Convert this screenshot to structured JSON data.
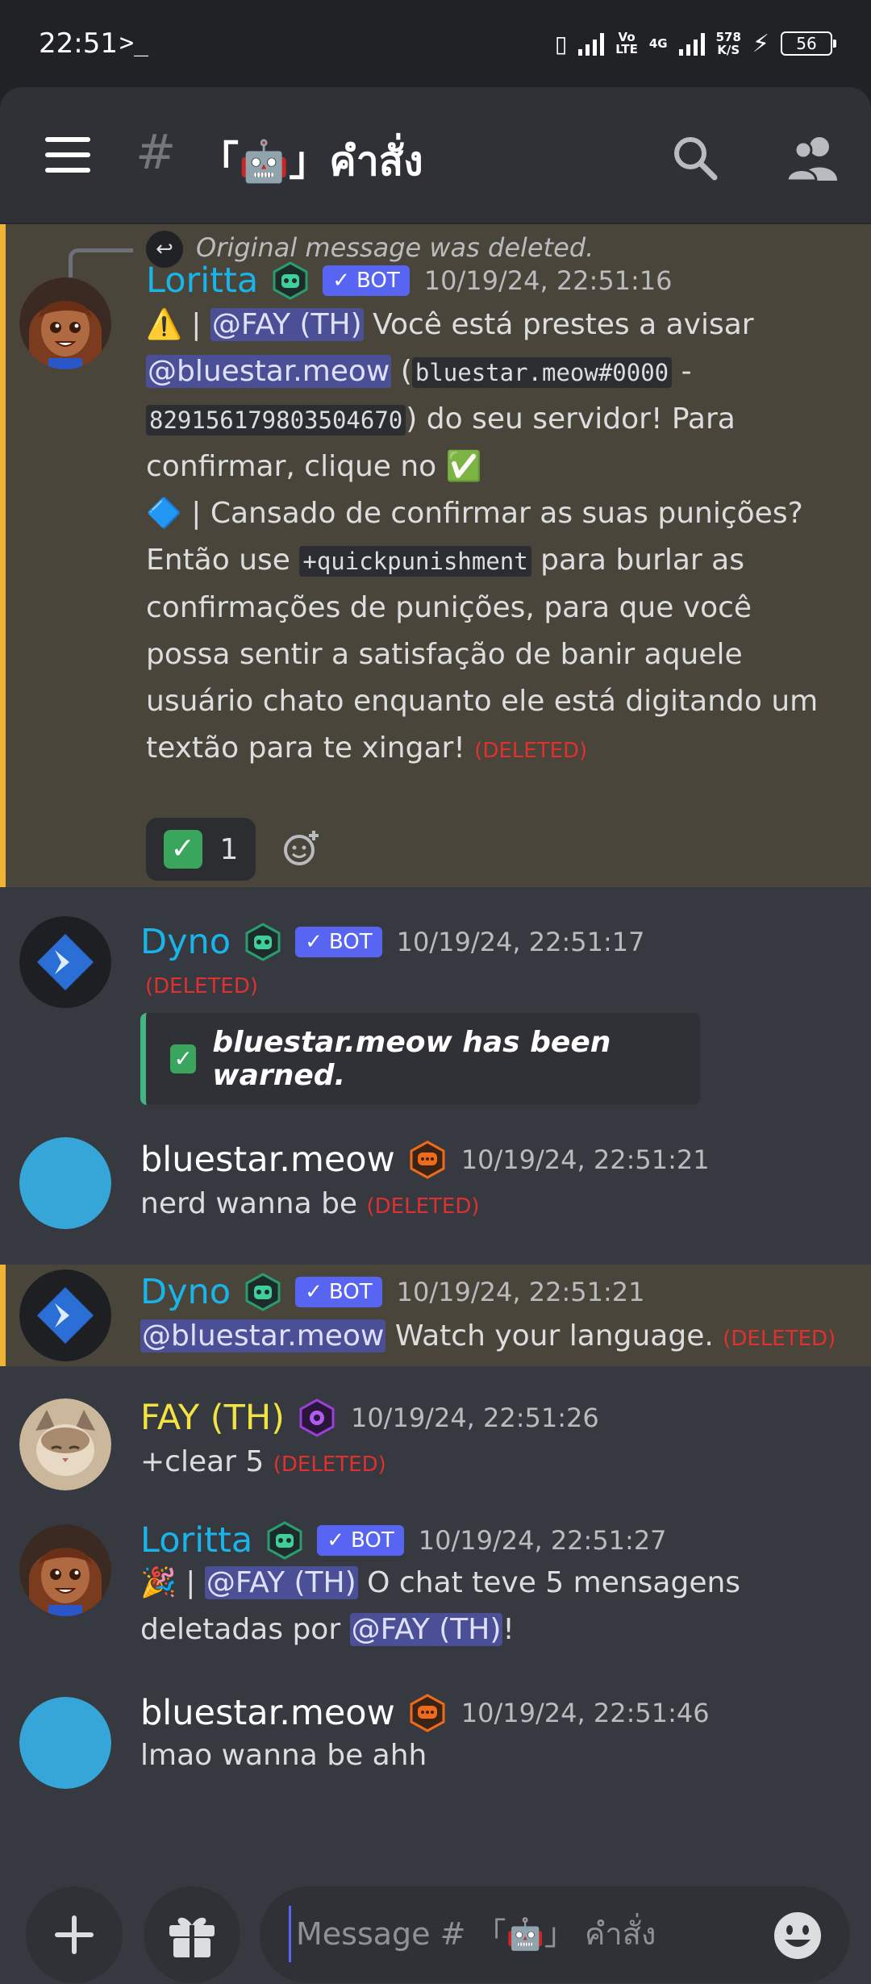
{
  "status_bar": {
    "time": "22:51",
    "terminal": ">_",
    "volte": "Vo\nLTE",
    "network": "4G",
    "speed": "578\nK/S",
    "battery": "56"
  },
  "header": {
    "channel_prefix": "#",
    "channel_name": "「🤖」คำสั่ง"
  },
  "messages": [
    {
      "reply_text": "Original message was deleted.",
      "author": "Loritta",
      "bot_tag": "BOT",
      "timestamp": "10/19/24, 22:51:16",
      "p1_pre": "⚠️ | ",
      "p1_mention": "@FAY (TH)",
      "p1_text": " Você está prestes a avisar ",
      "p1_mention2": "@bluestar.meow",
      "p1_text2": " (",
      "p1_code1": "bluestar.meow#0000",
      "p1_text3": " - ",
      "p1_code2": "829156179803504670",
      "p1_text4": ") do seu servidor! Para confirmar, clique no ✅",
      "p2_pre": "🔷 | Cansado de confirmar as suas punições? Então use ",
      "p2_code": "+quickpunishment",
      "p2_text": " para burlar as confirmações de punições, para que você possa sentir a satisfação de banir aquele usuário chato enquanto ele está digitando um textão para te xingar! ",
      "deleted": "(DELETED)",
      "reaction_emoji": "✓",
      "reaction_count": "1"
    },
    {
      "author": "Dyno",
      "bot_tag": "BOT",
      "timestamp": "10/19/24, 22:51:17",
      "deleted": "(DELETED)",
      "embed_check": "✓",
      "embed_text": "bluestar.meow has been warned."
    },
    {
      "author": "bluestar.meow",
      "timestamp": "10/19/24, 22:51:21",
      "text": "nerd wanna be ",
      "deleted": "(DELETED)"
    },
    {
      "author": "Dyno",
      "bot_tag": "BOT",
      "timestamp": "10/19/24, 22:51:21",
      "mention": "@bluestar.meow",
      "text": " Watch your language. ",
      "deleted": "(DELETED)"
    },
    {
      "author": "FAY (TH)",
      "timestamp": "10/19/24, 22:51:26",
      "text": "+clear 5 ",
      "deleted": "(DELETED)"
    },
    {
      "author": "Loritta",
      "bot_tag": "BOT",
      "timestamp": "10/19/24, 22:51:27",
      "pre": "🎉 | ",
      "mention": "@FAY (TH)",
      "text": " O chat teve 5 mensagens deletadas por ",
      "mention2": "@FAY (TH)",
      "post": "!"
    },
    {
      "author": "bluestar.meow",
      "timestamp": "10/19/24, 22:51:46",
      "text": "lmao wanna be ahh"
    }
  ],
  "composer": {
    "add_label": "+",
    "placeholder": "Message # 「🤖」 คำสั่ง"
  },
  "colors": {
    "bot_name": "#19b5ea",
    "fay_name": "#f1e341",
    "highlight_bg": "#4a453a",
    "highlight_bar": "#f0b232",
    "bot_tag": "#5865f2",
    "deleted": "#e03030"
  },
  "icons": {
    "menu": "hamburger-icon",
    "search": "search-icon",
    "members": "members-icon",
    "gift": "gift-icon",
    "emoji": "emoji-icon",
    "reply": "reply-icon",
    "add_reaction": "add-reaction-icon"
  }
}
